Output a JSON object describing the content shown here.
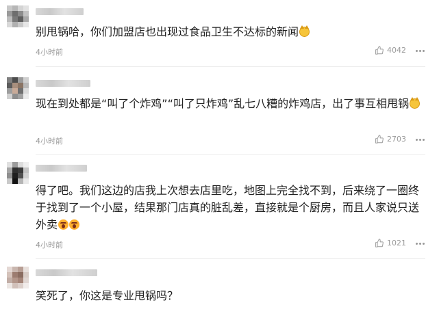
{
  "comments": [
    {
      "text": "别甩锅哈，你们加盟店也出现过食品卫生不达标的新闻",
      "time": "4小时前",
      "likes": "4042",
      "emojis": [
        "cat-icon"
      ]
    },
    {
      "text": "现在到处都是“叫了个炸鸡”“叫了只炸鸡”乱七八糟的炸鸡店，出了事互相甩锅",
      "time": "4小时前",
      "likes": "2703",
      "emojis": [
        "cat-icon"
      ]
    },
    {
      "text": "得了吧。我们这边的店我上次想去店里吃，地图上完全找不到，后来绕了一圈终于找到了一个小屋，结果那门店真的脏乱差，直接就是个厨房，而且人家说只送外卖",
      "time": "4小时前",
      "likes": "1021",
      "emojis": [
        "shocked-face-icon",
        "shocked-face-icon"
      ]
    },
    {
      "text": "笑死了，你这是专业甩锅吗？",
      "time": "",
      "likes": "",
      "emojis": []
    }
  ],
  "icons": {
    "like": "thumbs-up-icon",
    "more": "more-dots-icon"
  },
  "colors": {
    "text": "#222222",
    "meta": "#999999",
    "divider": "#ececec"
  }
}
